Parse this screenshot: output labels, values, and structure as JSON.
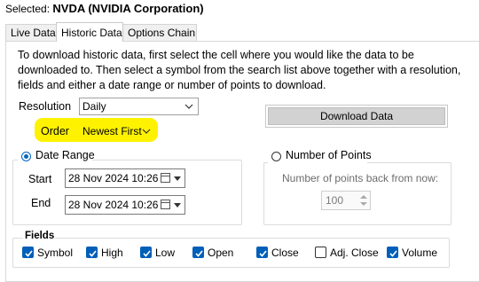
{
  "header": {
    "selected_prefix": "Selected:",
    "selected_symbol": "NVDA (NVIDIA Corporation)"
  },
  "tabs": [
    {
      "label": "Live Data",
      "active": false
    },
    {
      "label": "Historic Data",
      "active": true
    },
    {
      "label": "Options Chain",
      "active": false
    }
  ],
  "instructions": "To download historic data, first select the cell where you would like the data to be downloaded to. Then select a symbol from the search list above together with a resolution, fields and either a date range or number of points to download.",
  "resolution": {
    "label": "Resolution",
    "value": "Daily"
  },
  "order": {
    "label": "Order",
    "value": "Newest First",
    "highlight_color": "#fff200"
  },
  "download_button": "Download Data",
  "date_range": {
    "label": "Date Range",
    "selected": true,
    "start_label": "Start",
    "start_value": "28 Nov 2024 10:26",
    "end_label": "End",
    "end_value": "28 Nov 2024 10:26"
  },
  "number_of_points": {
    "label": "Number of Points",
    "selected": false,
    "prompt": "Number of points back from now:",
    "value": "100"
  },
  "fields": {
    "title": "Fields",
    "items": [
      {
        "label": "Symbol",
        "checked": true
      },
      {
        "label": "High",
        "checked": true
      },
      {
        "label": "Low",
        "checked": true
      },
      {
        "label": "Open",
        "checked": true
      },
      {
        "label": "Close",
        "checked": true
      },
      {
        "label": "Adj. Close",
        "checked": false
      },
      {
        "label": "Volume",
        "checked": true
      }
    ]
  },
  "colors": {
    "accent": "#005fb8",
    "highlight": "#fff200",
    "button_bg": "#d2d2d2"
  }
}
